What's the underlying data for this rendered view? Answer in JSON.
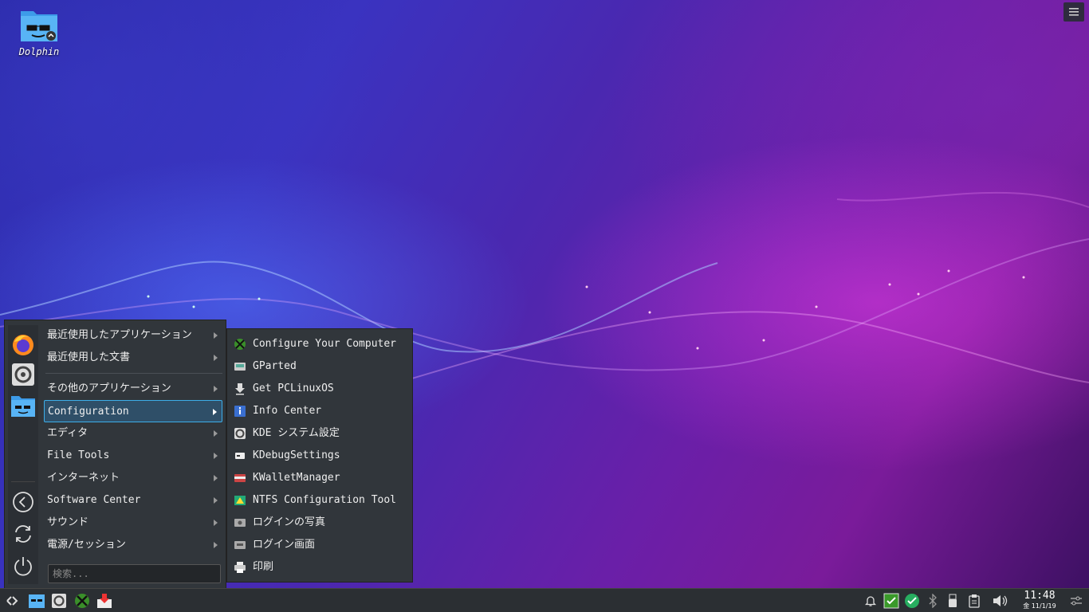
{
  "desktop": {
    "icons": [
      {
        "label": "Dolphin",
        "icon": "dolphin-icon"
      }
    ]
  },
  "launcher": {
    "categories": [
      {
        "label": "最近使用したアプリケーション"
      },
      {
        "label": "最近使用した文書"
      },
      {
        "label": "その他のアプリケーション"
      },
      {
        "label": "Configuration",
        "active": true
      },
      {
        "label": "エディタ"
      },
      {
        "label": "File Tools"
      },
      {
        "label": "インターネット"
      },
      {
        "label": "Software Center"
      },
      {
        "label": "サウンド"
      },
      {
        "label": "電源/セッション"
      }
    ],
    "search_placeholder": "検索..."
  },
  "submenu": {
    "items": [
      {
        "label": "Configure Your Computer",
        "icon": "configure-computer-icon"
      },
      {
        "label": "GParted",
        "icon": "gparted-icon"
      },
      {
        "label": "Get PCLinuxOS",
        "icon": "download-installer-icon"
      },
      {
        "label": "Info Center",
        "icon": "info-center-icon"
      },
      {
        "label": "KDE システム設定",
        "icon": "system-settings-icon"
      },
      {
        "label": "KDebugSettings",
        "icon": "kdebug-icon"
      },
      {
        "label": "KWalletManager",
        "icon": "kwallet-icon"
      },
      {
        "label": "NTFS Configuration Tool",
        "icon": "ntfs-config-icon"
      },
      {
        "label": "ログインの写真",
        "icon": "login-photo-icon"
      },
      {
        "label": "ログイン画面",
        "icon": "login-screen-icon"
      },
      {
        "label": "印刷",
        "icon": "printer-icon"
      }
    ]
  },
  "taskbar": {
    "clock": {
      "time": "11:48",
      "date": "金 11/1/19"
    }
  },
  "colors": {
    "accent": "#3daee9",
    "panel": "#31363b",
    "taskbar": "#2b2f33"
  }
}
